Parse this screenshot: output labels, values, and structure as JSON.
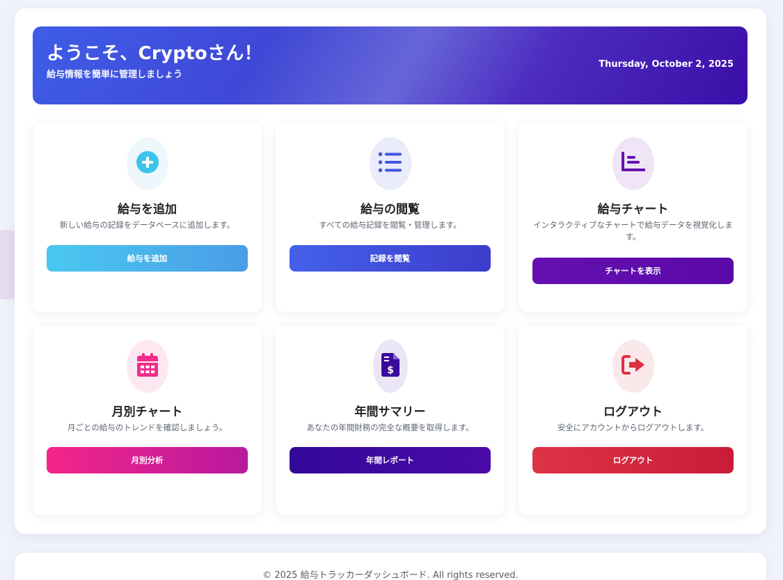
{
  "banner": {
    "title": "ようこそ、Cryptoさん！",
    "subtitle": "給与情報を簡単に管理しましょう",
    "date": "Thursday, October 2, 2025"
  },
  "cards": [
    {
      "title": "給与を追加",
      "description": "新しい給与の記録をデータベースに追加します。",
      "button": "給与を追加",
      "icon": "plus-circle-icon",
      "icon_color": "#3cc4ea",
      "icon_bg": "#edf7fc",
      "button_gradient": [
        "#4ac8f0",
        "#4a9de8"
      ]
    },
    {
      "title": "給与の閲覧",
      "description": "すべての給与記録を閲覧・管理します。",
      "button": "記録を閲覧",
      "icon": "list-icon",
      "icon_color": "#4356e3",
      "icon_bg": "#eaecfb",
      "button_gradient": [
        "#4461ea",
        "#3d3ccc"
      ]
    },
    {
      "title": "給与チャート",
      "description": "インタラクティブなチャートで給与データを視覚化します。",
      "button": "チャートを表示",
      "icon": "chart-icon",
      "icon_color": "#6411ad",
      "icon_bg": "#f0e5f7",
      "button_gradient": [
        "#6410b0",
        "#5a0aa8"
      ]
    },
    {
      "title": "月別チャート",
      "description": "月ごとの給与のトレンドを確認しましょう。",
      "button": "月別分析",
      "icon": "calendar-icon",
      "icon_color": "#f02d8a",
      "icon_bg": "#fde8f1",
      "button_gradient": [
        "#f32589",
        "#b8199e"
      ]
    },
    {
      "title": "年間サマリー",
      "description": "あなたの年間財務の完全な概要を取得します。",
      "button": "年間レポート",
      "icon": "invoice-dollar-icon",
      "icon_color": "#3b0a9e",
      "icon_bg": "#ebe6f6",
      "button_gradient": [
        "#33099a",
        "#4b0aa8"
      ]
    },
    {
      "title": "ログアウト",
      "description": "安全にアカウントからログアウトします。",
      "button": "ログアウト",
      "icon": "sign-out-icon",
      "icon_color": "#dc3142",
      "icon_bg": "#fae8ea",
      "button_gradient": [
        "#dc3445",
        "#c91c38"
      ]
    }
  ],
  "footer": {
    "text": "© 2025 給与トラッカーダッシュボード. All rights reserved."
  }
}
